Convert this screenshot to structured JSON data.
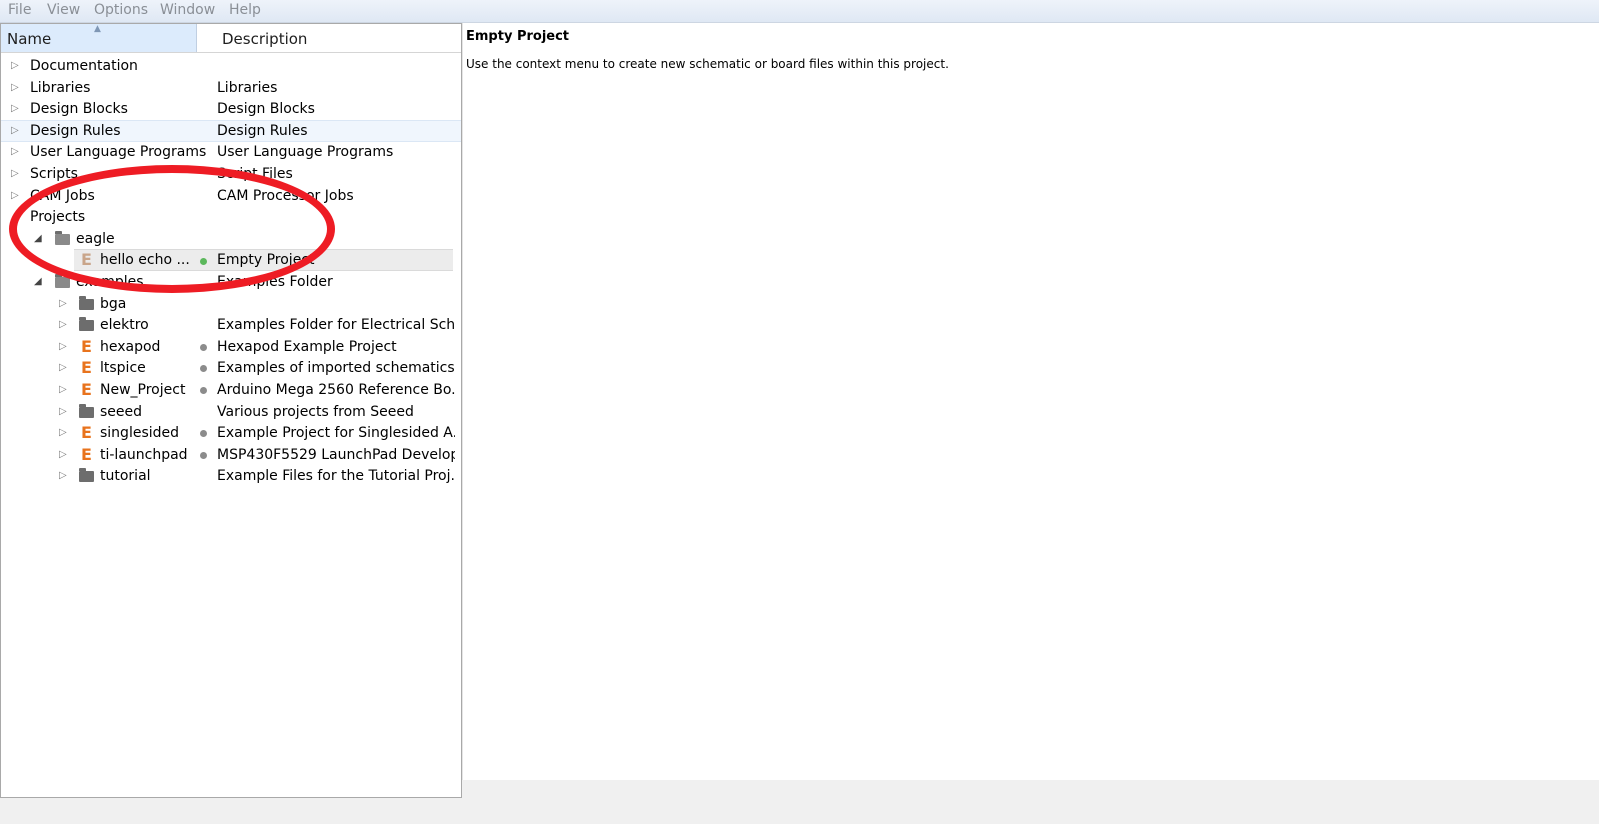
{
  "menu": [
    "File",
    "View",
    "Options",
    "Window",
    "Help"
  ],
  "tree": {
    "columns": {
      "name": "Name",
      "description": "Description"
    },
    "items": [
      {
        "name": "Documentation",
        "desc": "",
        "expander": "closed",
        "icon": "none",
        "dot": "none"
      },
      {
        "name": "Libraries",
        "desc": "Libraries",
        "expander": "closed",
        "icon": "none",
        "dot": "none"
      },
      {
        "name": "Design Blocks",
        "desc": "Design Blocks",
        "expander": "closed",
        "icon": "none",
        "dot": "none"
      },
      {
        "name": "Design Rules",
        "desc": "Design Rules",
        "expander": "closed",
        "icon": "none",
        "dot": "none"
      },
      {
        "name": "User Language Programs",
        "desc": "User Language Programs",
        "expander": "closed",
        "icon": "none",
        "dot": "none"
      },
      {
        "name": "Scripts",
        "desc": "Script Files",
        "expander": "closed",
        "icon": "none",
        "dot": "none"
      },
      {
        "name": "CAM Jobs",
        "desc": "CAM Processor Jobs",
        "expander": "closed",
        "icon": "none",
        "dot": "none"
      },
      {
        "name": "Projects",
        "desc": "",
        "expander": "none",
        "icon": "none",
        "dot": "none"
      },
      {
        "name": "eagle",
        "desc": "",
        "expander": "open",
        "icon": "folder-open-icon",
        "dot": "none"
      },
      {
        "name": "hello echo ...",
        "desc": "Empty Project",
        "expander": "none",
        "icon": "eagle-project-icon",
        "dot": "green"
      },
      {
        "name": "examples",
        "desc": "Examples Folder",
        "expander": "open",
        "icon": "folder-open-icon",
        "dot": "none"
      },
      {
        "name": "bga",
        "desc": "",
        "expander": "closed",
        "icon": "folder-icon",
        "dot": "none"
      },
      {
        "name": "elektro",
        "desc": "Examples Folder for Electrical Sch...",
        "expander": "closed",
        "icon": "folder-icon",
        "dot": "none"
      },
      {
        "name": "hexapod",
        "desc": "Hexapod Example Project",
        "expander": "closed",
        "icon": "eagle-project-icon",
        "dot": "gray"
      },
      {
        "name": "ltspice",
        "desc": "Examples of imported schematics ...",
        "expander": "closed",
        "icon": "eagle-project-icon",
        "dot": "gray"
      },
      {
        "name": "New_Project",
        "desc": "Arduino Mega 2560 Reference Bo...",
        "expander": "closed",
        "icon": "eagle-project-icon",
        "dot": "gray"
      },
      {
        "name": "seeed",
        "desc": "Various projects from Seeed",
        "expander": "closed",
        "icon": "folder-icon",
        "dot": "none"
      },
      {
        "name": "singlesided",
        "desc": "Example Project for Singlesided A...",
        "expander": "closed",
        "icon": "eagle-project-icon",
        "dot": "gray"
      },
      {
        "name": "ti-launchpad",
        "desc": "MSP430F5529 LaunchPad Develop...",
        "expander": "closed",
        "icon": "eagle-project-icon",
        "dot": "gray"
      },
      {
        "name": "tutorial",
        "desc": "Example Files for the Tutorial Proj...",
        "expander": "closed",
        "icon": "folder-icon",
        "dot": "none"
      }
    ]
  },
  "detail": {
    "title": "Empty Project",
    "text": "Use the context menu to create new schematic or board files within this project."
  },
  "colors": {
    "accent_red": "#ee1c24",
    "eagle_orange": "#e8731d",
    "status_green": "#5cb85c"
  }
}
